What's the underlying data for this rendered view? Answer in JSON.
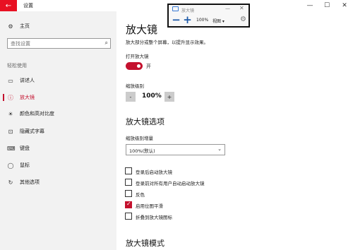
{
  "window": {
    "title": "设置",
    "back_icon": "back-arrow-icon",
    "controls": {
      "minimize": "—",
      "maximize": "☐",
      "close": "✕"
    }
  },
  "sidebar": {
    "home_label": "主页",
    "search_placeholder": "查找设置",
    "group_label": "轻松使用",
    "items": [
      {
        "label": "讲述人",
        "icon": "narrator-icon",
        "glyph": "▭"
      },
      {
        "label": "放大镜",
        "icon": "magnifier-icon",
        "glyph": "ⓘ",
        "active": true
      },
      {
        "label": "颜色和高对比度",
        "icon": "brightness-icon",
        "glyph": "☀"
      },
      {
        "label": "隐藏式字幕",
        "icon": "captions-icon",
        "glyph": "⊡"
      },
      {
        "label": "键盘",
        "icon": "keyboard-icon",
        "glyph": "⌨"
      },
      {
        "label": "鼠标",
        "icon": "mouse-icon",
        "glyph": "◯"
      },
      {
        "label": "其他选项",
        "icon": "other-options-icon",
        "glyph": "↻"
      }
    ]
  },
  "main": {
    "title": "放大镜",
    "description": "放大部分或整个屏幕，以提升显示效果。",
    "toggle_label": "打开放大镜",
    "toggle_state": "开",
    "zoom_label": "缩放级别",
    "zoom_value": "100%",
    "minus_label": "-",
    "plus_label": "+",
    "options_title": "放大镜选项",
    "increment_label": "缩放级别增量",
    "increment_value": "100%(默认)",
    "checkboxes": [
      {
        "label": "登录后启动放大镜",
        "checked": false
      },
      {
        "label": "登录前对所有用户自动启动放大镜",
        "checked": false
      },
      {
        "label": "反色",
        "checked": false
      },
      {
        "label": "启用位图平滑",
        "checked": true
      },
      {
        "label": "折叠到放大镜图标",
        "checked": false
      }
    ],
    "mode_title": "放大镜模式"
  },
  "magnifier_toolbar": {
    "title": "放大镜",
    "minus": "−",
    "plus": "+",
    "zoom": "100%",
    "view_label": "视图 ▾",
    "min": "—",
    "close": "✕",
    "gear": "⚙"
  },
  "colors": {
    "accent": "#c4112e",
    "back_button": "#e81123",
    "sidebar_bg": "#f2f2f2"
  }
}
